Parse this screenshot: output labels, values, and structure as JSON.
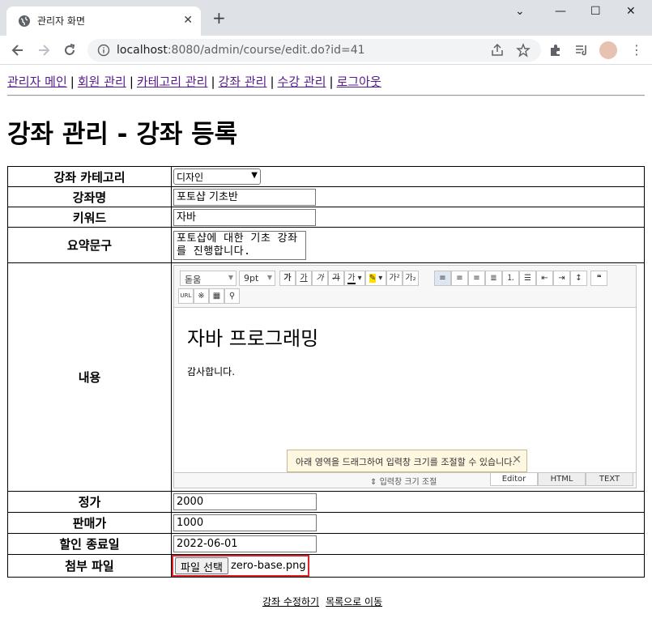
{
  "browser": {
    "tab_title": "관리자 화면",
    "url_host": "localhost",
    "url_path": ":8080/admin/course/edit.do?id=41"
  },
  "topnav": {
    "items": [
      "관리자 메인",
      "회원 관리",
      "카테고리 관리",
      "강좌 관리",
      "수강 관리",
      "로그아웃"
    ]
  },
  "heading": "강좌 관리 - 강좌 등록",
  "form": {
    "category_label": "강좌 카테고리",
    "category_value": "디자인",
    "name_label": "강좌명",
    "name_value": "포토샵 기초반",
    "keyword_label": "키워드",
    "keyword_value": "자바",
    "summary_label": "요약문구",
    "summary_value": "포토샵에 대한 기초 강좌를 진행합니다.",
    "content_label": "내용",
    "price_label": "정가",
    "price_value": "2000",
    "sale_label": "판매가",
    "sale_value": "1000",
    "discount_end_label": "할인 종료일",
    "discount_end_value": "2022-06-01",
    "file_label": "첨부 파일",
    "file_button": "파일 선택",
    "file_name": "zero-base.png"
  },
  "editor": {
    "font_select": "돋움",
    "size_select": "9pt",
    "content_heading": "자바 프로그래밍",
    "content_text": "감사합니다.",
    "tip_text": "아래 영역을 드래그하여 입력창 크기를 조절할 수 있습니다.",
    "resize_label": "입력창 크기 조절",
    "tabs": [
      "Editor",
      "HTML",
      "TEXT"
    ],
    "active_tab": "Editor"
  },
  "actions": {
    "submit_label": "강좌 수정하기",
    "list_label": "목록으로 이동"
  }
}
